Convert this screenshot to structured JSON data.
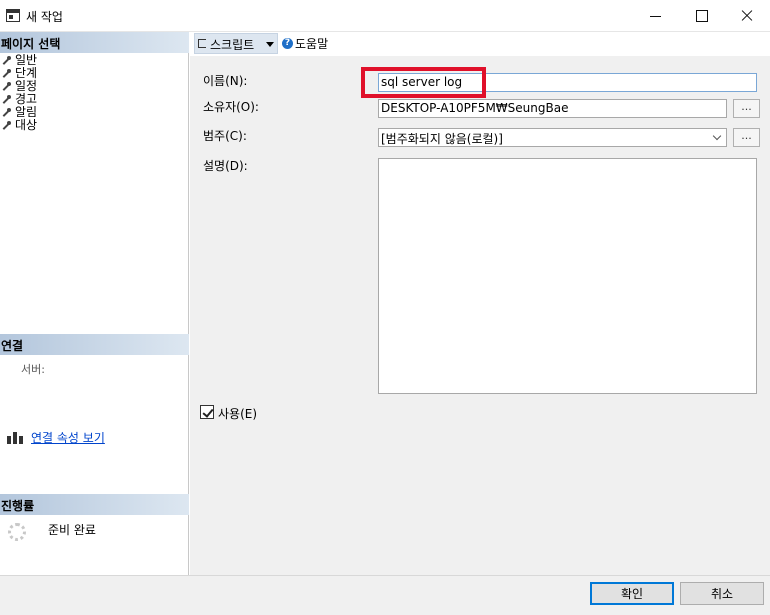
{
  "window": {
    "title": "새 작업"
  },
  "left_pane": {
    "page_select_header": "페이지 선택",
    "pages": [
      {
        "label": "일반"
      },
      {
        "label": "단계"
      },
      {
        "label": "일정"
      },
      {
        "label": "경고"
      },
      {
        "label": "알림"
      },
      {
        "label": "대상"
      }
    ],
    "connection_header": "연결",
    "server_label": "서버:",
    "connection_link": "연결 속성 보기",
    "progress_header": "진행률",
    "progress_status": "준비 완료"
  },
  "toolbar": {
    "script_label": "스크립트",
    "help_label": "도움말"
  },
  "form": {
    "name_label": "이름(N):",
    "name_value": "sql server log",
    "owner_label": "소유자(O):",
    "owner_value": "DESKTOP-A10PF5M₩SeungBae",
    "category_label": "범주(C):",
    "category_value": "[범주화되지 않음(로컬)]",
    "description_label": "설명(D):",
    "browse_label": "...",
    "enabled_label": "사용(E)",
    "enabled_checked": true
  },
  "buttons": {
    "ok": "확인",
    "cancel": "취소"
  },
  "colors": {
    "highlight_box": "#e0102a",
    "link": "#0044cc",
    "header_gradient_start": "#b3c6dc"
  }
}
